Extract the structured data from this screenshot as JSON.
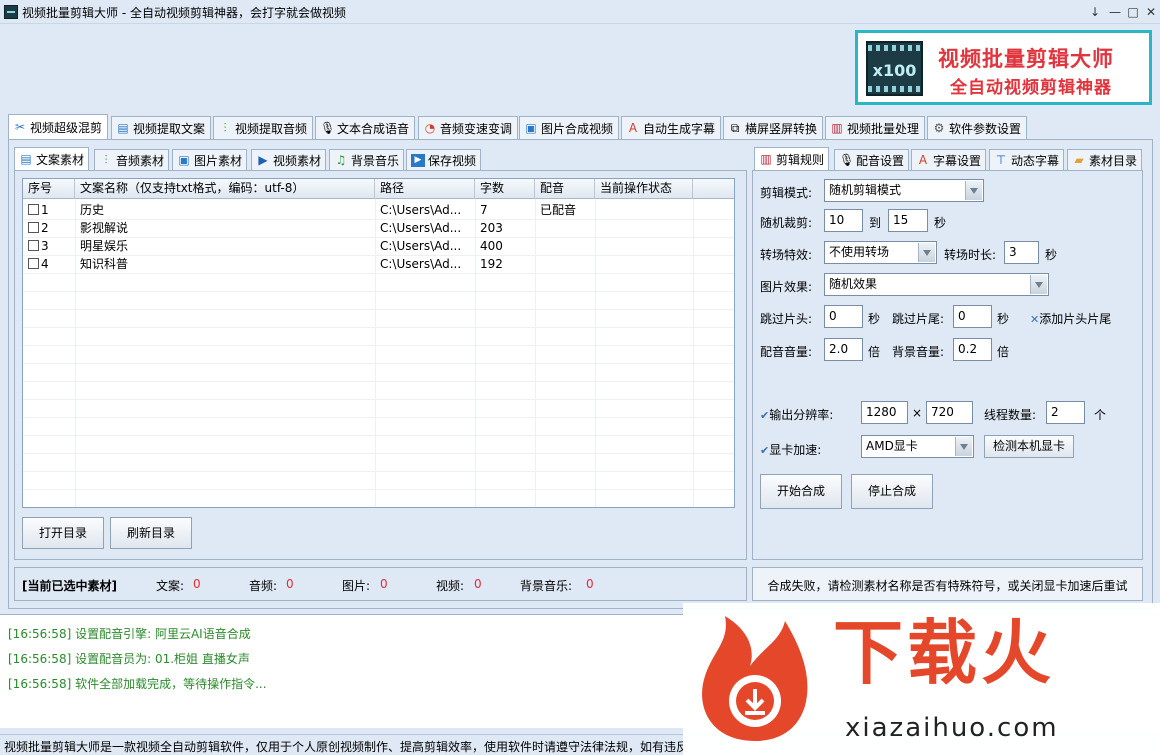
{
  "window": {
    "title": "视频批量剪辑大师 - 全自动视频剪辑神器，会打字就会做视频",
    "controls": [
      "↓",
      "—",
      "□",
      "✕"
    ]
  },
  "logo": {
    "badge": "x100",
    "title": "视频批量剪辑大师",
    "subtitle": "全自动视频剪辑神器"
  },
  "main_tabs": [
    {
      "label": "视频超级混剪",
      "icon": "scissors-icon",
      "active": true
    },
    {
      "label": "视频提取文案",
      "icon": "document-icon"
    },
    {
      "label": "视频提取音频",
      "icon": "audio-wave-icon"
    },
    {
      "label": "文本合成语音",
      "icon": "microphone-icon"
    },
    {
      "label": "音频变速变调",
      "icon": "gauge-icon"
    },
    {
      "label": "图片合成视频",
      "icon": "image-icon"
    },
    {
      "label": "自动生成字幕",
      "icon": "subtitle-icon"
    },
    {
      "label": "横屏竖屏转换",
      "icon": "rotate-screen-icon"
    },
    {
      "label": "视频批量处理",
      "icon": "film-icon"
    },
    {
      "label": "软件参数设置",
      "icon": "gear-icon"
    }
  ],
  "left_tabs": [
    {
      "label": "文案素材",
      "active": true
    },
    {
      "label": "音频素材"
    },
    {
      "label": "图片素材"
    },
    {
      "label": "视频素材"
    },
    {
      "label": "背景音乐"
    },
    {
      "label": "保存视频"
    }
  ],
  "table": {
    "columns": [
      "序号",
      "文案名称（仅支持txt格式，编码：utf-8）",
      "路径",
      "字数",
      "配音",
      "当前操作状态"
    ],
    "rows": [
      {
        "no": "1",
        "name": "历史",
        "path": "C:\\Users\\Ad...",
        "count": "7",
        "dub": "已配音",
        "state": ""
      },
      {
        "no": "2",
        "name": "影视解说",
        "path": "C:\\Users\\Ad...",
        "count": "203",
        "dub": "",
        "state": ""
      },
      {
        "no": "3",
        "name": "明星娱乐",
        "path": "C:\\Users\\Ad...",
        "count": "400",
        "dub": "",
        "state": ""
      },
      {
        "no": "4",
        "name": "知识科普",
        "path": "C:\\Users\\Ad...",
        "count": "192",
        "dub": "",
        "state": ""
      }
    ]
  },
  "left_buttons": {
    "open": "打开目录",
    "refresh": "刷新目录"
  },
  "selected": {
    "title": "[当前已选中素材]",
    "items": [
      {
        "label": "文案:",
        "value": "0"
      },
      {
        "label": "音频:",
        "value": "0"
      },
      {
        "label": "图片:",
        "value": "0"
      },
      {
        "label": "视频:",
        "value": "0"
      },
      {
        "label": "背景音乐:",
        "value": "0"
      }
    ]
  },
  "right_tabs": [
    {
      "label": "剪辑规则",
      "active": true
    },
    {
      "label": "配音设置"
    },
    {
      "label": "字幕设置"
    },
    {
      "label": "动态字幕"
    },
    {
      "label": "素材目录"
    }
  ],
  "rules": {
    "mode_label": "剪辑模式:",
    "mode_value": "随机剪辑模式",
    "crop_label": "随机裁剪:",
    "crop_from": "10",
    "crop_to_label": "到",
    "crop_to": "15",
    "sec": "秒",
    "transition_label": "转场特效:",
    "transition_value": "不使用转场",
    "transition_dur_label": "转场时长:",
    "transition_dur": "3",
    "image_label": "图片效果:",
    "image_value": "随机效果",
    "skip_head_label": "跳过片头:",
    "skip_head": "0",
    "skip_tail_label": "跳过片尾:",
    "skip_tail": "0",
    "add_head_tail": "添加片头片尾",
    "dub_vol_label": "配音音量:",
    "dub_vol": "2.0",
    "times": "倍",
    "bg_vol_label": "背景音量:",
    "bg_vol": "0.2",
    "res_label": "输出分辨率:",
    "res_w": "1280",
    "res_x": "×",
    "res_h": "720",
    "threads_label": "线程数量:",
    "threads": "2",
    "unit_ge": "个",
    "gpu_label": "显卡加速:",
    "gpu_value": "AMD显卡",
    "detect_gpu": "检测本机显卡",
    "start": "开始合成",
    "stop": "停止合成"
  },
  "status_msg": "合成失败，请检测素材名称是否有特殊符号，或关闭显卡加速后重试",
  "log": [
    {
      "time": "[16:56:58]",
      "text": "设置配音引擎:   阿里云AI语音合成"
    },
    {
      "time": "[16:56:58]",
      "text": "设置配音员为: 01.柜姐 直播女声"
    },
    {
      "time": "[16:56:58]",
      "text": "软件全部加载完成，等待操作指令..."
    }
  ],
  "statusbar": "视频批量剪辑大师是一款视频全自动剪辑软件，仅用于个人原创视频制作、提高剪辑效率，使用软件时请遵守法律法规，如有违反",
  "watermark": {
    "cn": "下载火",
    "en": "xiazaihuo.com"
  },
  "colors": {
    "accent": "#2bb6c4",
    "brand_red": "#e1353e",
    "log_green": "#2c8a2c",
    "watermark_orange": "#e5472a"
  }
}
